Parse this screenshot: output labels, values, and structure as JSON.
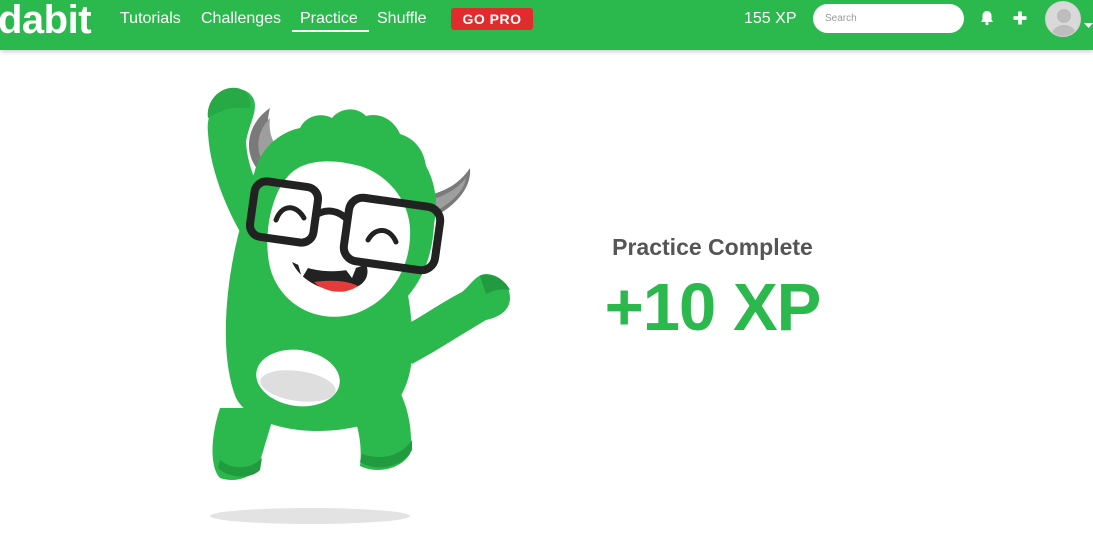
{
  "brand": {
    "logo_text": "dabit",
    "accent_color": "#2bb84c",
    "pro_color": "#e02c2c"
  },
  "nav": {
    "items": [
      {
        "label": "Tutorials"
      },
      {
        "label": "Challenges"
      },
      {
        "label": "Practice",
        "active": true
      },
      {
        "label": "Shuffle"
      }
    ],
    "gopro_label": "GO PRO",
    "xp_label": "155 XP",
    "search_placeholder": "Search",
    "icons": [
      "bell-icon",
      "plus-icon",
      "avatar",
      "caret-down-icon"
    ]
  },
  "main": {
    "title": "Practice Complete",
    "xp_earned": "+10 XP",
    "illustration": "green-monster-mascot"
  }
}
